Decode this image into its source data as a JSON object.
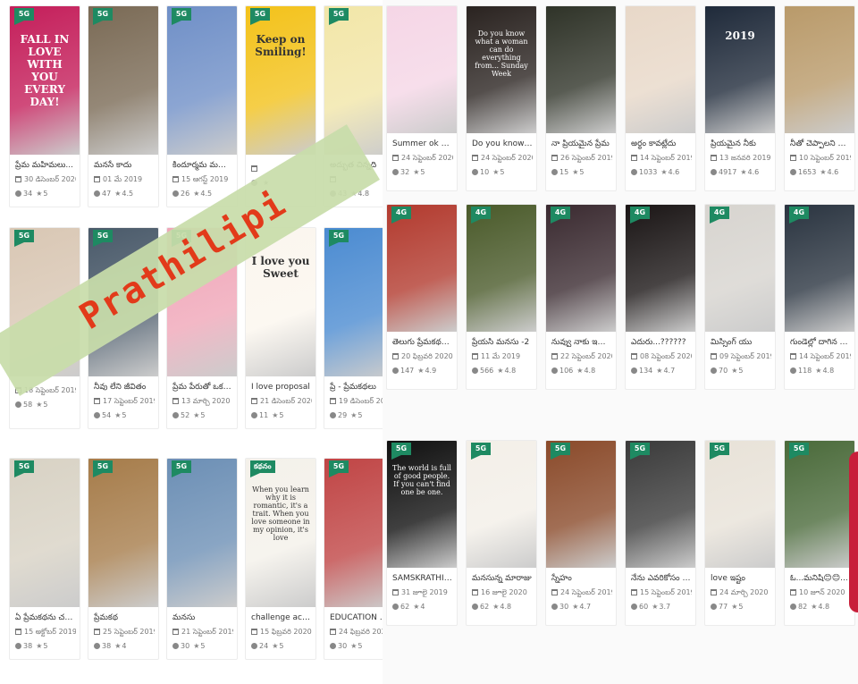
{
  "watermark": {
    "label": "Prathilipi"
  },
  "left_grid": {
    "rows": [
      [
        {
          "badge": "5G",
          "title": "ప్రేమ మహిమలు...",
          "date": "30 డిసెంబర్ 2020",
          "views": "34",
          "rating": "5",
          "cover_text": "FALL IN LOVE WITH YOU EVERY DAY!",
          "cover_color": "#c41e5a"
        },
        {
          "badge": "5G",
          "title": "మనసే కాదు",
          "date": "01 మే 2019",
          "views": "47",
          "rating": "4.5",
          "cover_text": "",
          "cover_color": "#7a6a55"
        },
        {
          "badge": "5G",
          "title": "కిందూర్మమ మహ...",
          "date": "15 ఆగస్ట్ 2019",
          "views": "26",
          "rating": "4.5",
          "cover_text": "",
          "cover_color": "#6f8fc7"
        },
        {
          "badge": "5G",
          "title": "",
          "date": "",
          "views": "",
          "rating": "",
          "cover_text": "Keep on Smiling!",
          "cover_color": "#f3c21a"
        },
        {
          "badge": "5G",
          "title": "అద్భుత చిన్నది",
          "date": "",
          "views": "43",
          "rating": "4.8",
          "cover_text": "",
          "cover_color": "#f2e6a8"
        }
      ],
      [
        {
          "badge": "5G",
          "title": "",
          "date": "18 సెప్టెంబర్ 2019",
          "views": "58",
          "rating": "5",
          "cover_text": "",
          "cover_color": "#d9c7b4"
        },
        {
          "badge": "5G",
          "title": "నీవు లేని జీవితం",
          "date": "17 సెప్టెంబర్ 2019",
          "views": "54",
          "rating": "5",
          "cover_text": "",
          "cover_color": "#4a5a6a"
        },
        {
          "badge": "5G",
          "title": "ప్రేమ పేరుతో ఒక ప్రేమ...",
          "date": "13 మార్చి 2020",
          "views": "52",
          "rating": "5",
          "cover_text": "",
          "cover_color": "#f0a6b8"
        },
        {
          "badge": "",
          "title": "I love proposal",
          "date": "21 డిసెంబర్ 2020",
          "views": "11",
          "rating": "5",
          "cover_text": "I love you Sweet",
          "cover_color": "#fbf6ee"
        },
        {
          "badge": "5G",
          "title": "ప్రే - ప్రేమకథలు",
          "date": "19 డిసెంబర్ 2019",
          "views": "29",
          "rating": "5",
          "cover_text": "",
          "cover_color": "#4b8bd1"
        }
      ],
      [
        {
          "badge": "5G",
          "title": "ఏ ప్రేమకథను చదవండి",
          "date": "15 అక్టోబర్ 2019",
          "views": "38",
          "rating": "5",
          "cover_text": "",
          "cover_color": "#d8d2c4"
        },
        {
          "badge": "5G",
          "title": "ప్రేమకథ",
          "date": "25 సెప్టెంబర్ 2019",
          "views": "38",
          "rating": "4",
          "cover_text": "",
          "cover_color": "#a67c4a"
        },
        {
          "badge": "5G",
          "title": "మనసు",
          "date": "21 సెప్టెంబర్ 2019",
          "views": "30",
          "rating": "5",
          "cover_text": "",
          "cover_color": "#6c8fb5"
        },
        {
          "badge": "కథనం",
          "title": "challenge accepted😍",
          "date": "15 ఫిబ్రవరి 2020",
          "views": "24",
          "rating": "5",
          "cover_text": "When you learn why it is romantic, it's a trait. When you love someone in my opinion, it's love",
          "cover_color": "#f4f1ea"
        },
        {
          "badge": "5G",
          "title": "EDUCATION SYST...",
          "date": "24 ఫిబ్రవరి 2020",
          "views": "30",
          "rating": "5",
          "cover_text": "",
          "cover_color": "#c04545"
        }
      ]
    ]
  },
  "right_grid": {
    "rows": [
      [
        {
          "badge": "",
          "title": "Summer ok proposed...",
          "date": "24 సెప్టెంబర్ 2020",
          "views": "32",
          "rating": "5",
          "cover_text": "",
          "cover_color": "#f5d6e6"
        },
        {
          "badge": "",
          "title": "Do you know what a...",
          "date": "24 సెప్టెంబర్ 2020",
          "views": "10",
          "rating": "5",
          "cover_text": "Do you know what a woman can do everything from... Sunday Week",
          "cover_color": "#2a2320"
        },
        {
          "badge": "",
          "title": "నా ప్రియమైన ప్రేమ",
          "date": "26 సెప్టెంబర్ 2019",
          "views": "15",
          "rating": "5",
          "cover_text": "",
          "cover_color": "#2f3328"
        },
        {
          "badge": "",
          "title": "అర్థం కావట్లేదు",
          "date": "14 సెప్టెంబర్ 2019",
          "views": "1033",
          "rating": "4.6",
          "cover_text": "",
          "cover_color": "#e8d8c8"
        },
        {
          "badge": "",
          "title": "ప్రియమైన నీకు",
          "date": "13 జనవరి 2019",
          "views": "4917",
          "rating": "4.6",
          "cover_text": "2019",
          "cover_color": "#1f2a3a"
        },
        {
          "badge": "",
          "title": "నీతో చెప్పాలని ఉంది",
          "date": "10 సెప్టెంబర్ 2019",
          "views": "1653",
          "rating": "4.6",
          "cover_text": "",
          "cover_color": "#b99a6a"
        }
      ],
      [
        {
          "badge": "4G",
          "title": "తెలుగు ప్రేమకథలు -2",
          "date": "20 ఫిబ్రవరి 2020",
          "views": "147",
          "rating": "4.9",
          "cover_text": "",
          "cover_color": "#b23a2e"
        },
        {
          "badge": "4G",
          "title": "ప్రేయసి మనసు -2",
          "date": "11 మే 2019",
          "views": "566",
          "rating": "4.8",
          "cover_text": "",
          "cover_color": "#4a5a2a"
        },
        {
          "badge": "4G",
          "title": "నువ్వు నాకు ఇష్టం...",
          "date": "22 సెప్టెంబర్ 2020",
          "views": "106",
          "rating": "4.8",
          "cover_text": "",
          "cover_color": "#3a2a30"
        },
        {
          "badge": "4G",
          "title": "ఎదురు...??????",
          "date": "08 సెప్టెంబర్ 2020",
          "views": "134",
          "rating": "4.7",
          "cover_text": "",
          "cover_color": "#1a1515"
        },
        {
          "badge": "4G",
          "title": "మిస్సింగ్ యు",
          "date": "09 సెప్టెంబర్ 2019",
          "views": "70",
          "rating": "5",
          "cover_text": "",
          "cover_color": "#d7d4cf"
        },
        {
          "badge": "4G",
          "title": "గుండెల్లో దాగిన ప్రేమ...",
          "date": "14 సెప్టెంబర్ 2019",
          "views": "118",
          "rating": "4.8",
          "cover_text": "",
          "cover_color": "#2a3440"
        }
      ],
      [
        {
          "badge": "5G",
          "title": "SAMSKRATHI THE MA...",
          "date": "31 జూలై 2019",
          "views": "62",
          "rating": "4",
          "cover_text": "The world is full of good people. If you can't find one be one.",
          "cover_color": "#101010"
        },
        {
          "badge": "5G",
          "title": "మనసున్న మారాజు",
          "date": "16 జూలై 2020",
          "views": "62",
          "rating": "4.8",
          "cover_text": "",
          "cover_color": "#f3efe8"
        },
        {
          "badge": "5G",
          "title": "స్నేహం",
          "date": "24 సెప్టెంబర్ 2019",
          "views": "30",
          "rating": "4.7",
          "cover_text": "",
          "cover_color": "#8a4a2a"
        },
        {
          "badge": "5G",
          "title": "నేను ఎవరికోసం వచ...",
          "date": "15 సెప్టెంబర్ 2019",
          "views": "60",
          "rating": "3.7",
          "cover_text": "",
          "cover_color": "#3a3a3a"
        },
        {
          "badge": "5G",
          "title": "love ఇష్టం",
          "date": "24 మార్చి 2020",
          "views": "77",
          "rating": "5",
          "cover_text": "",
          "cover_color": "#e8e2d8"
        },
        {
          "badge": "5G",
          "title": "ఓ...మనిషి😊😊...",
          "date": "10 జూన్ 2020",
          "views": "82",
          "rating": "4.8",
          "cover_text": "",
          "cover_color": "#4a6a3a"
        }
      ]
    ]
  }
}
